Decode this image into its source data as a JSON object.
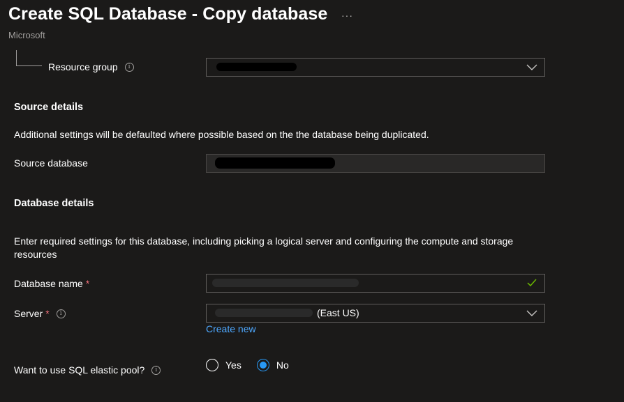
{
  "header": {
    "title": "Create SQL Database - Copy database",
    "more_label": "···",
    "subtitle": "Microsoft"
  },
  "resource_group": {
    "label": "Resource group",
    "value": ""
  },
  "source_details": {
    "heading": "Source details",
    "description": "Additional settings will be defaulted where possible based on the the database being duplicated.",
    "source_database_label": "Source database",
    "source_database_value": ""
  },
  "database_details": {
    "heading": "Database details",
    "description": "Enter required settings for this database, including picking a logical server and configuring the compute and storage resources",
    "database_name_label": "Database name",
    "database_name_value": "",
    "server_label": "Server",
    "server_value": "(East US)",
    "create_new_label": "Create new",
    "elastic_pool_label": "Want to use SQL elastic pool?",
    "elastic_pool_options": [
      "Yes",
      "No"
    ],
    "elastic_pool_selected": "No"
  },
  "colors": {
    "background": "#1b1a19",
    "link": "#4ea8ff",
    "required": "#f1707b",
    "valid": "#6bb700",
    "radio_checked": "#2899f5"
  },
  "icons": {
    "more": "more-icon",
    "info": "info-icon",
    "chevron": "chevron-down-icon",
    "check": "checkmark-icon"
  }
}
